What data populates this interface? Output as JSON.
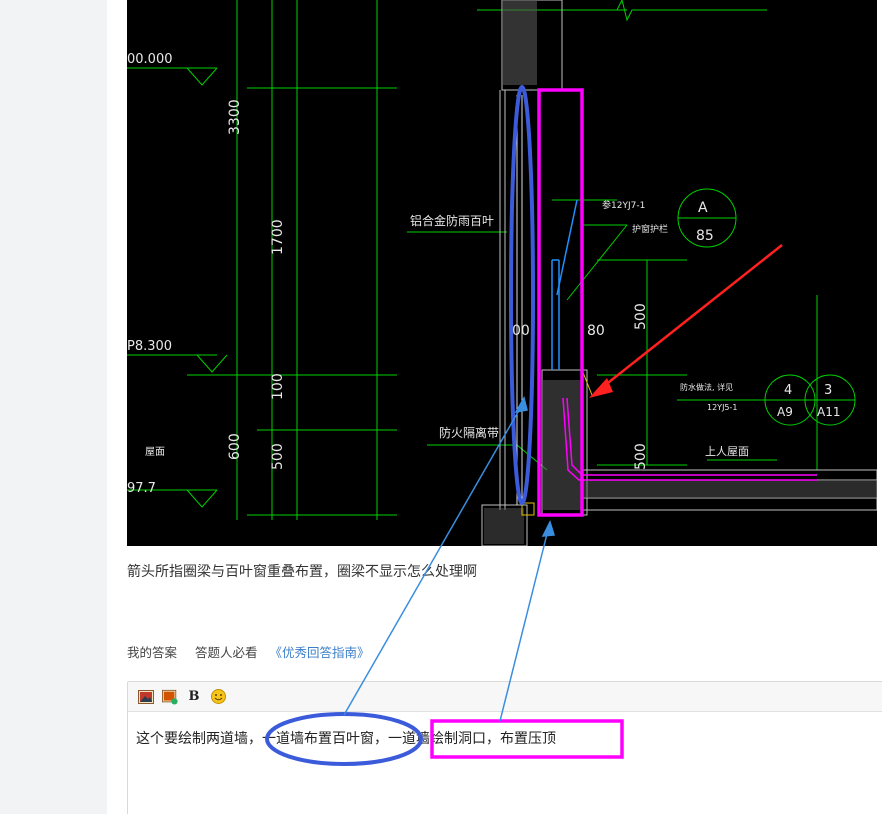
{
  "cad": {
    "elevations": [
      "00.000",
      "P8.300",
      "97.7"
    ],
    "dims": [
      "3300",
      "1700",
      "100",
      "600",
      "500",
      "500",
      "500",
      "00",
      "80"
    ],
    "labels": {
      "louver": "铝合金防雨百叶",
      "firebreak": "防火隔离带",
      "ref": "参12YJ7-1",
      "guard": "护窗护栏",
      "roof_top": "上人屋面",
      "roof_left": "屋面",
      "note": "防水做法, 详见",
      "ref2": "12YJ5-1"
    },
    "bubbles": [
      {
        "top": "A",
        "bottom": "85"
      },
      {
        "top": "4",
        "bottom": "A9"
      },
      {
        "top": "3",
        "bottom": "A11"
      }
    ],
    "colors": {
      "grid": "#00d000",
      "annotation_pink": "#ff00ff",
      "annotation_blue": "#3b5bdb",
      "arrow_red": "#ff2020",
      "pointer_blue": "#3a8ee0"
    }
  },
  "question": "箭头所指圈梁与百叶窗重叠布置，圈梁不显示怎么处理啊",
  "tabs": {
    "my_answer": "我的答案",
    "must_read": "答题人必看",
    "guide": "《优秀回答指南》"
  },
  "toolbar": {
    "image_icon": "image-icon",
    "gallery_icon": "gallery-icon",
    "bold_label": "B",
    "emoji_icon": "emoji-icon"
  },
  "answer": {
    "part1": "这个要绘制两道墙，",
    "part2": "一道墙布置百叶窗，",
    "part3": "一",
    "part4": "道墙绘制洞口，布置压顶"
  }
}
